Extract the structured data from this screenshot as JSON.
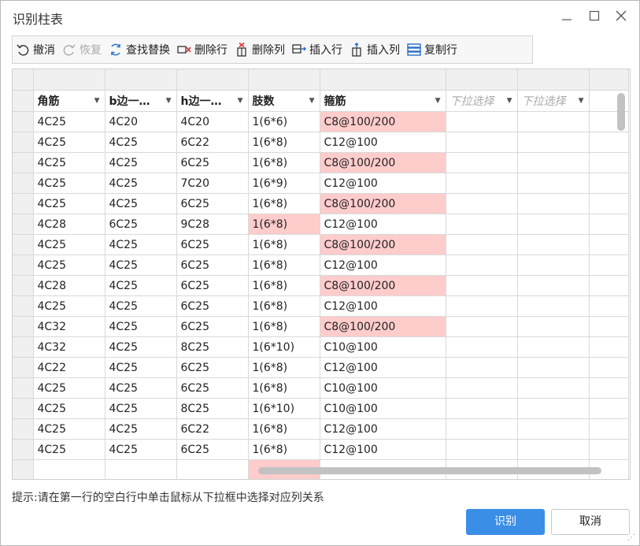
{
  "window": {
    "title": "识别柱表"
  },
  "toolbar": {
    "undo": "撤消",
    "redo": "恢复",
    "find_replace": "查找替换",
    "delete_row": "删除行",
    "delete_col": "删除列",
    "insert_row": "插入行",
    "insert_col": "插入列",
    "copy_row": "复制行"
  },
  "colors": {
    "highlight": "#ffcccc",
    "primary": "#3a8ee6"
  },
  "table": {
    "headers": [
      "角筋",
      "b边一…",
      "h边一…",
      "肢数",
      "箍筋",
      "下拉选择",
      "下拉选择"
    ],
    "rows": [
      [
        "4C25",
        "4C20",
        "4C20",
        "1(6*6)",
        "C8@100/200"
      ],
      [
        "4C25",
        "4C25",
        "6C22",
        "1(6*8)",
        "C12@100"
      ],
      [
        "4C25",
        "4C25",
        "6C25",
        "1(6*8)",
        "C8@100/200"
      ],
      [
        "4C25",
        "4C25",
        "7C20",
        "1(6*9)",
        "C12@100"
      ],
      [
        "4C25",
        "4C25",
        "6C25",
        "1(6*8)",
        "C8@100/200"
      ],
      [
        "4C28",
        "6C25",
        "9C28",
        "1(6*8)",
        "C12@100"
      ],
      [
        "4C25",
        "4C25",
        "6C25",
        "1(6*8)",
        "C8@100/200"
      ],
      [
        "4C25",
        "4C25",
        "6C25",
        "1(6*8)",
        "C12@100"
      ],
      [
        "4C28",
        "4C25",
        "6C25",
        "1(6*8)",
        "C8@100/200"
      ],
      [
        "4C25",
        "4C25",
        "6C25",
        "1(6*8)",
        "C12@100"
      ],
      [
        "4C32",
        "4C25",
        "6C25",
        "1(6*8)",
        "C8@100/200"
      ],
      [
        "4C32",
        "4C25",
        "8C25",
        "1(6*10)",
        "C10@100"
      ],
      [
        "4C22",
        "4C25",
        "6C25",
        "1(6*8)",
        "C12@100"
      ],
      [
        "4C25",
        "4C25",
        "6C25",
        "1(6*8)",
        "C10@100"
      ],
      [
        "4C25",
        "4C25",
        "8C25",
        "1(6*10)",
        "C10@100"
      ],
      [
        "4C25",
        "4C25",
        "6C22",
        "1(6*8)",
        "C12@100"
      ],
      [
        "4C25",
        "4C25",
        "6C25",
        "1(6*8)",
        "C12@100"
      ]
    ]
  },
  "hint": "提示:请在第一行的空白行中单击鼠标从下拉框中选择对应列关系",
  "buttons": {
    "ok": "识别",
    "cancel": "取消"
  }
}
